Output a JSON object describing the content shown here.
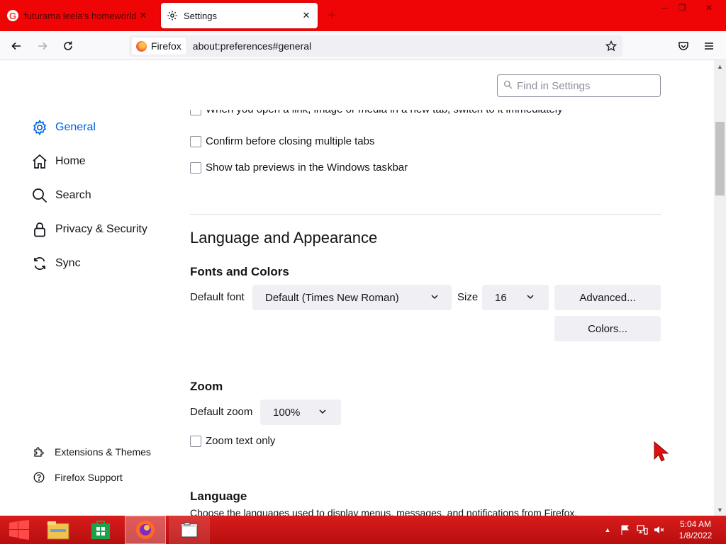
{
  "browser": {
    "tabs": [
      {
        "title": "futurama leela's homeworld - ",
        "icon": "google-icon",
        "active": false
      },
      {
        "title": "Settings",
        "icon": "gear-icon",
        "active": true
      }
    ],
    "window_controls": [
      "minimize",
      "restore",
      "close"
    ],
    "identity_label": "Firefox",
    "url": "about:preferences#general"
  },
  "settings": {
    "find_placeholder": "Find in Settings",
    "sidebar": [
      {
        "label": "General",
        "icon": "gear-icon",
        "selected": true
      },
      {
        "label": "Home",
        "icon": "home-icon",
        "selected": false
      },
      {
        "label": "Search",
        "icon": "search-icon",
        "selected": false
      },
      {
        "label": "Privacy & Security",
        "icon": "lock-icon",
        "selected": false
      },
      {
        "label": "Sync",
        "icon": "sync-icon",
        "selected": false
      }
    ],
    "sidebar_footer": [
      {
        "label": "Extensions & Themes",
        "icon": "puzzle-icon"
      },
      {
        "label": "Firefox Support",
        "icon": "help-icon"
      }
    ],
    "tabs_options": {
      "cut_off_label": "When you open a link, image or media in a new tab, switch to it immediately",
      "confirm_close": "Confirm before closing multiple tabs",
      "tab_previews": "Show tab previews in the Windows taskbar"
    },
    "language_appearance": {
      "heading": "Language and Appearance",
      "fonts_heading": "Fonts and Colors",
      "default_font_label": "Default font",
      "default_font_value": "Default (Times New Roman)",
      "size_label": "Size",
      "size_value": "16",
      "advanced_button": "Advanced...",
      "colors_button": "Colors..."
    },
    "zoom": {
      "heading": "Zoom",
      "default_zoom_label": "Default zoom",
      "default_zoom_value": "100%",
      "zoom_text_only": "Zoom text only"
    },
    "language": {
      "heading": "Language",
      "cut_off_description": "Choose the languages used to display menus, messages, and notifications from Firefox."
    }
  },
  "taskbar": {
    "apps": [
      "start-icon",
      "file-explorer-icon",
      "store-icon",
      "firefox-icon",
      "window-icon"
    ],
    "clock_time": "5:04 AM",
    "clock_date": "1/8/2022"
  },
  "colors": {
    "theme_red": "#ef0505",
    "accent_blue": "#0061e0",
    "taskbar_red": "#c81414"
  }
}
